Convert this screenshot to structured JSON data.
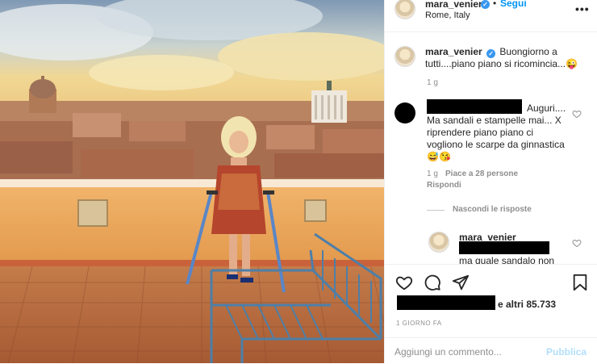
{
  "post_header": {
    "username": "mara_venier",
    "dot": "•",
    "follow_label": "Segui",
    "location": "Rome, Italy",
    "more_icon": "more-options-icon",
    "more_label": "•••"
  },
  "caption": {
    "username": "mara_venier",
    "text": "Buongiorno a tutti....piano piano si ricomincia...😜",
    "time": "1 g"
  },
  "comment": {
    "text": "Auguri.... Ma sandali e stampelle mai... X riprendere piano piano ci vogliono le scarpe da ginnastica 😅😘",
    "time": "1 g",
    "likes": "Piace a 28 persone",
    "reply_label": "Rispondi",
    "hide_replies_label": "Nascondi le risposte"
  },
  "reply": {
    "username": "mara_venier",
    "text": "ma quale sandalo non"
  },
  "actions": {
    "like_icon": "heart-icon",
    "comment_icon": "comment-icon",
    "share_icon": "paper-plane-icon",
    "save_icon": "bookmark-icon",
    "likes_text": "e altri 85.733",
    "timestamp": "1 giorno fa",
    "comment_placeholder": "Aggiungi un commento...",
    "publish_label": "Pubblica"
  },
  "colors": {
    "accent": "#0095f6",
    "verified": "#3897f0",
    "publish_disabled": "#b2dffc",
    "muted": "#8e8e8e"
  }
}
